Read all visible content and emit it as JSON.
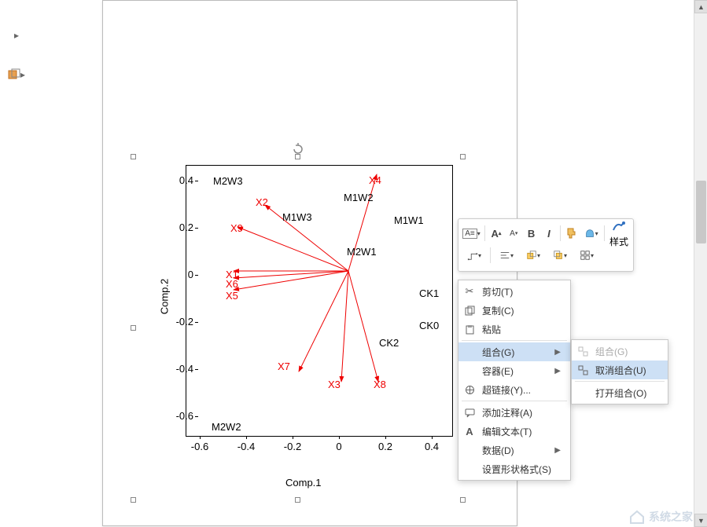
{
  "chart_data": {
    "type": "scatter",
    "title": "",
    "xlabel": "Comp.1",
    "ylabel": "Comp.2",
    "xlim": [
      -0.7,
      0.5
    ],
    "ylim": [
      -0.7,
      0.45
    ],
    "xticks": [
      -0.6,
      -0.4,
      -0.2,
      0.0,
      0.2,
      0.4
    ],
    "yticks": [
      -0.6,
      -0.4,
      -0.2,
      0.0,
      0.2,
      0.4
    ],
    "points": [
      {
        "label": "M2W3",
        "x": -0.48,
        "y": 0.4
      },
      {
        "label": "M1W3",
        "x": -0.24,
        "y": 0.27
      },
      {
        "label": "M1W2",
        "x": 0.1,
        "y": 0.32
      },
      {
        "label": "M1W1",
        "x": 0.28,
        "y": 0.27
      },
      {
        "label": "M2W1",
        "x": 0.1,
        "y": 0.11
      },
      {
        "label": "CK1",
        "x": 0.35,
        "y": -0.1
      },
      {
        "label": "CK0",
        "x": 0.35,
        "y": -0.18
      },
      {
        "label": "CK2",
        "x": 0.22,
        "y": -0.28
      },
      {
        "label": "M2W2",
        "x": -0.48,
        "y": -0.62
      }
    ],
    "vectors": [
      {
        "label": "X4",
        "x": 0.12,
        "y": 0.41
      },
      {
        "label": "X2",
        "x": -0.4,
        "y": 0.33
      },
      {
        "label": "X9",
        "x": -0.5,
        "y": 0.22
      },
      {
        "label": "X1",
        "x": -0.52,
        "y": 0.02
      },
      {
        "label": "X6",
        "x": -0.52,
        "y": -0.01
      },
      {
        "label": "X5",
        "x": -0.52,
        "y": -0.06
      },
      {
        "label": "X7",
        "x": -0.25,
        "y": -0.45
      },
      {
        "label": "X3",
        "x": -0.05,
        "y": -0.5
      },
      {
        "label": "X8",
        "x": 0.12,
        "y": -0.5
      }
    ]
  },
  "mini_toolbar": {
    "style_label": "样式"
  },
  "context_menu": {
    "cut": "剪切(T)",
    "copy": "复制(C)",
    "paste": "粘贴",
    "group": "组合(G)",
    "container": "容器(E)",
    "hyperlink": "超链接(Y)...",
    "add_comment": "添加注释(A)",
    "edit_text": "编辑文本(T)",
    "data": "数据(D)",
    "format_shape": "设置形状格式(S)"
  },
  "sub_menu": {
    "group": "组合(G)",
    "ungroup": "取消组合(U)",
    "open_group": "打开组合(O)"
  },
  "watermark": "系统之家"
}
